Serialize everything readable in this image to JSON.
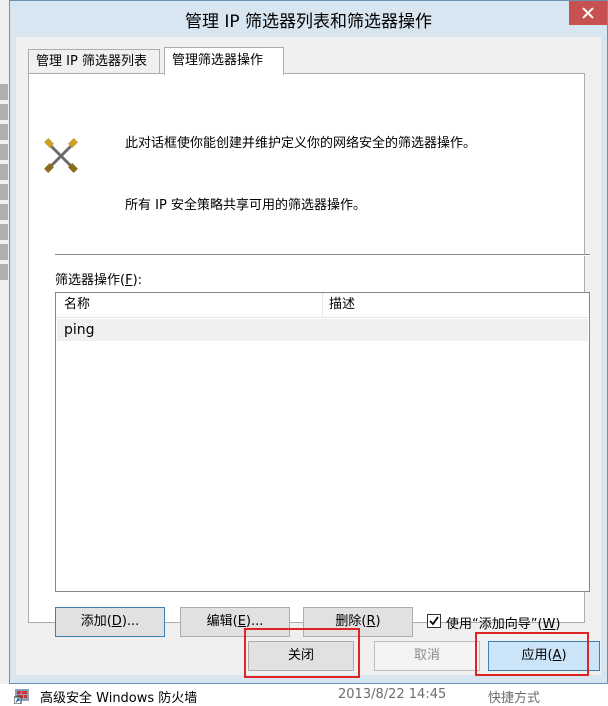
{
  "window": {
    "title": "管理 IP 筛选器列表和筛选器操作"
  },
  "tabs": [
    {
      "label": "管理 IP 筛选器列表"
    },
    {
      "label": "管理筛选器操作"
    }
  ],
  "content": {
    "description_1": "此对话框使你能创建并维护定义你的网络安全的筛选器操作。",
    "description_2": "所有 IP 安全策略共享可用的筛选器操作。",
    "list_label_prefix": "筛选器操作(",
    "list_label_key": "F",
    "list_label_suffix": "):",
    "columns": [
      "名称",
      "描述"
    ],
    "rows": [
      {
        "name": "ping",
        "description": ""
      }
    ]
  },
  "buttons": {
    "add": {
      "prefix": "添加(",
      "key": "D",
      "suffix": ")..."
    },
    "edit": {
      "prefix": "编辑(",
      "key": "E",
      "suffix": ")..."
    },
    "delete": {
      "prefix": "删除(",
      "key": "R",
      "suffix": ")"
    },
    "wizard": {
      "prefix": "使用“添加向导”(",
      "key": "W",
      "suffix": ")",
      "checked": true
    },
    "close": "关闭",
    "cancel": "取消",
    "apply": {
      "prefix": "应用(",
      "key": "A",
      "suffix": ")"
    }
  },
  "background_item": {
    "name": "高级安全 Windows 防火墙",
    "date": "2013/8/22 14:45",
    "type": "快捷方式"
  },
  "colors": {
    "highlight": "#e02424",
    "accent": "#3c7fb1",
    "titlebar": "#d8e6f2"
  }
}
